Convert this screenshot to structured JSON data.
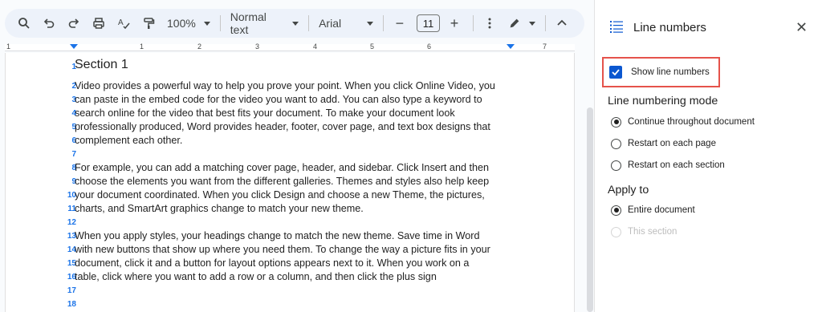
{
  "toolbar": {
    "zoom": "100%",
    "style": "Normal text",
    "font": "Arial",
    "font_size": "11",
    "minus": "−",
    "plus": "+"
  },
  "ruler": {
    "numbers": [
      "1",
      "1",
      "2",
      "3",
      "4",
      "5",
      "6",
      "7"
    ]
  },
  "document": {
    "lines": [
      {
        "n": "1",
        "text": "Section 1"
      },
      {
        "n": "2",
        "text": "Video provides a powerful way to help you prove your point. When you click Online Video, you"
      },
      {
        "n": "3",
        "text": "can paste in the embed code for the video you want to add. You can also type a keyword to"
      },
      {
        "n": "4",
        "text": "search online for the video that best fits your document. To make your document look"
      },
      {
        "n": "5",
        "text": "professionally produced, Word provides header, footer, cover page, and text box designs that"
      },
      {
        "n": "6",
        "text": "complement each other."
      },
      {
        "n": "7",
        "text": ""
      },
      {
        "n": "8",
        "text": "For example, you can add a matching cover page, header, and sidebar. Click Insert and then"
      },
      {
        "n": "9",
        "text": "choose the elements you want from the different galleries. Themes and styles also help keep"
      },
      {
        "n": "10",
        "text": "your document coordinated. When you click Design and choose a new Theme, the pictures,"
      },
      {
        "n": "11",
        "text": "charts, and SmartArt graphics change to match your new theme."
      },
      {
        "n": "12",
        "text": ""
      },
      {
        "n": "13",
        "text": "When you apply styles, your headings change to match the new theme. Save time in Word"
      },
      {
        "n": "14",
        "text": "with new buttons that show up where you need them. To change the way a picture fits in your"
      },
      {
        "n": "15",
        "text": "document, click it and a button for layout options appears next to it. When you work on a"
      },
      {
        "n": "16",
        "text": "table, click where you want to add a row or a column, and then click the plus sign"
      },
      {
        "n": "17",
        "text": ""
      },
      {
        "n": "18",
        "text": ""
      }
    ]
  },
  "panel": {
    "title": "Line numbers",
    "show_label": "Show line numbers",
    "mode_title": "Line numbering mode",
    "modes": [
      "Continue throughout document",
      "Restart on each page",
      "Restart on each section"
    ],
    "apply_title": "Apply to",
    "apply_options": [
      "Entire document",
      "This section"
    ]
  },
  "colors": {
    "accent": "#0b57d0",
    "line_number": "#1a73e8",
    "highlight_box": "#e5534b",
    "toolbar_bg": "#edf2fa"
  }
}
